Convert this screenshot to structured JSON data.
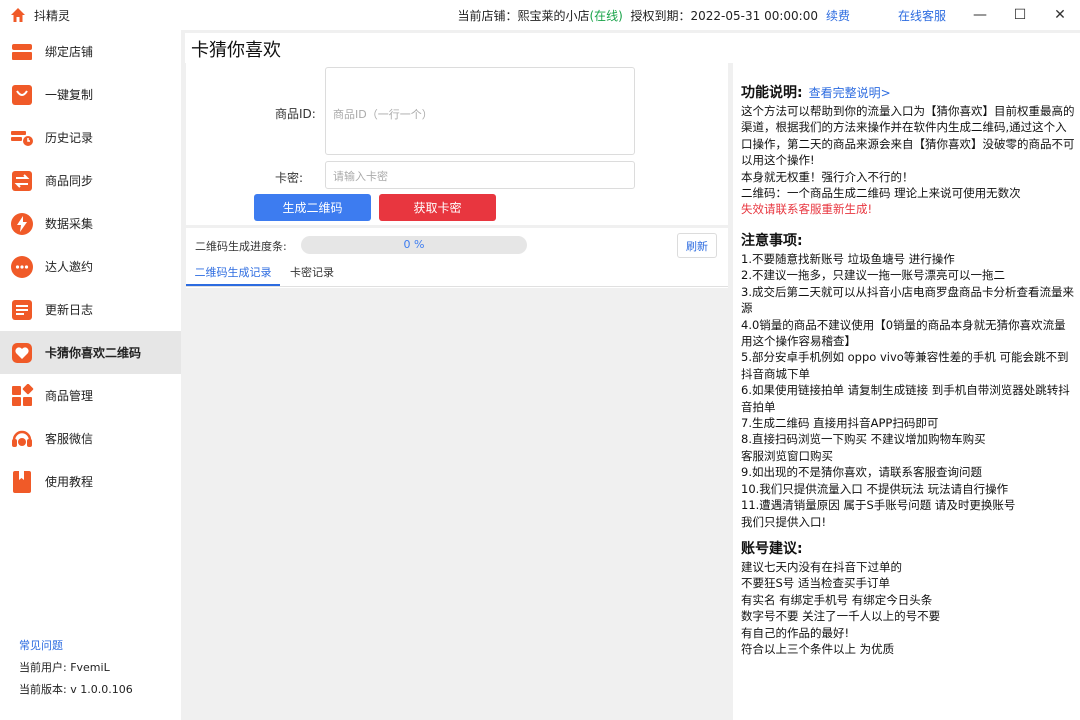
{
  "window": {
    "title": "抖精灵",
    "store_label": "当前店铺：",
    "store_name": "熙宝莱的小店",
    "store_status": "(在线)",
    "expiry_label": "授权到期：",
    "expiry_value": "2022-05-31 00:00:00",
    "renew_label": "续费",
    "cs_label": "在线客服",
    "min_glyph": "—",
    "max_glyph": "☐",
    "close_glyph": "✕"
  },
  "sidebar": {
    "items": [
      {
        "label": "绑定店铺",
        "icon": "store-icon"
      },
      {
        "label": "一键复制",
        "icon": "copy-bag-icon"
      },
      {
        "label": "历史记录",
        "icon": "history-icon"
      },
      {
        "label": "商品同步",
        "icon": "sync-icon"
      },
      {
        "label": "数据采集",
        "icon": "lightning-icon"
      },
      {
        "label": "达人邀约",
        "icon": "chat-bubble-icon"
      },
      {
        "label": "更新日志",
        "icon": "log-list-icon"
      },
      {
        "label": "卡猜你喜欢二维码",
        "icon": "heart-icon"
      },
      {
        "label": "商品管理",
        "icon": "grid-manage-icon"
      },
      {
        "label": "客服微信",
        "icon": "headset-icon"
      },
      {
        "label": "使用教程",
        "icon": "bookmark-icon"
      }
    ],
    "active_index": 7,
    "faq_link": "常见问题",
    "user_label": "当前用户: FvemiL",
    "version_label": "当前版本: v 1.0.0.106"
  },
  "main": {
    "title": "卡猜你喜欢",
    "form": {
      "id_label": "商品ID:",
      "id_placeholder": "商品ID（一行一个）",
      "kami_label": "卡密:",
      "kami_placeholder": "请输入卡密",
      "generate_button": "生成二维码",
      "get_kami_button": "获取卡密"
    },
    "progress": {
      "label": "二维码生成进度条:",
      "value_percent": 0,
      "value_text": "0 %",
      "refresh_button": "刷新"
    },
    "tabs": [
      {
        "label": "二维码生成记录",
        "active": true
      },
      {
        "label": "卡密记录",
        "active": false
      }
    ]
  },
  "info": {
    "section1": {
      "heading": "功能说明:",
      "link": "查看完整说明>",
      "body": "这个方法可以帮助到你的流量入口为【猜你喜欢】目前权重最高的渠道，根据我们的方法来操作并在软件内生成二维码,通过这个入口操作，第二天的商品来源会来自【猜你喜欢】没破零的商品不可以用这个操作!\n本身就无权重！强行介入不行的！\n二维码：一个商品生成二维码 理论上来说可使用无数次",
      "warning": "失效请联系客服重新生成!"
    },
    "section2": {
      "heading": "注意事项:",
      "body": "1.不要随意找新账号 垃圾鱼塘号 进行操作\n2.不建议一拖多，只建议一拖一账号漂亮可以一拖二\n3.成交后第二天就可以从抖音小店电商罗盘商品卡分析查看流量来源\n4.0销量的商品不建议使用【0销量的商品本身就无猜你喜欢流量用这个操作容易稽查】\n5.部分安卓手机例如 oppo vivo等兼容性差的手机 可能会跳不到抖音商城下单\n6.如果使用链接拍单 请复制生成链接 到手机自带浏览器处跳转抖音拍单\n7.生成二维码 直接用抖音APP扫码即可\n8.直接扫码浏览一下购买 不建议增加购物车购买\n客服浏览窗口购买\n9.如出现的不是猜你喜欢，请联系客服查询问题\n10.我们只提供流量入口 不提供玩法 玩法请自行操作\n11.遭遇清销量原因 属于S手账号问题 请及时更换账号\n我们只提供入口!"
    },
    "section3": {
      "heading": "账号建议:",
      "body": "建议七天内没有在抖音下过单的\n不要狂S号 适当检查买手订单\n有实名 有绑定手机号 有绑定今日头条\n数字号不要 关注了一千人以上的号不要\n有自己的作品的最好!\n符合以上三个条件以上 为优质"
    }
  },
  "colors": {
    "accent_blue": "#3d7cf0",
    "brand_red": "#e8363f",
    "online_green": "#1aa34a",
    "icon_orange": "#f05a28"
  }
}
